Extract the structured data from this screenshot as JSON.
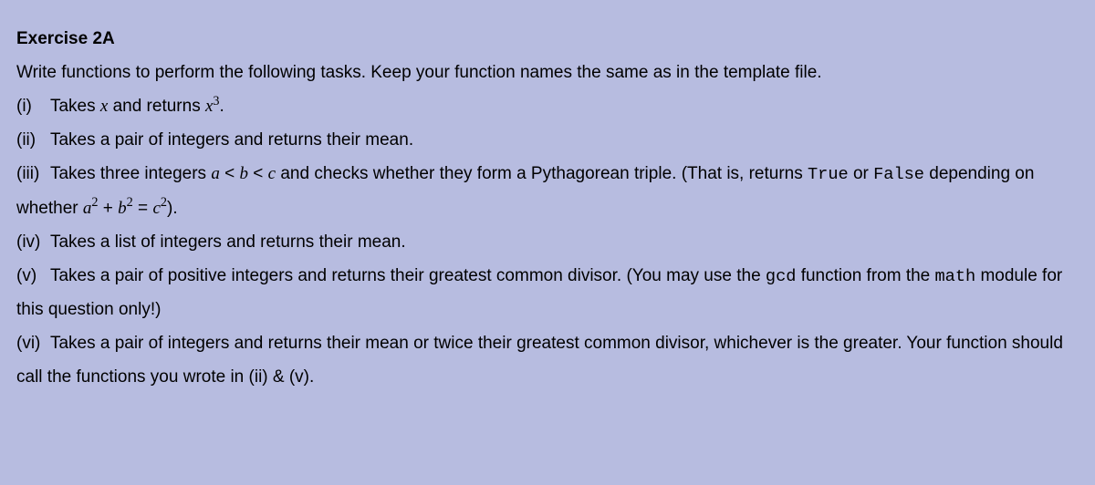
{
  "title": "Exercise 2A",
  "intro": "Write functions to perform the following tasks. Keep your function names the same as in the template file.",
  "items": {
    "i": {
      "label": "(i)"
    },
    "ii": {
      "label": "(ii)",
      "text": "Takes a pair of integers and returns their mean."
    },
    "iii": {
      "label": "(iii)"
    },
    "iv": {
      "label": "(iv)",
      "text": "Takes a list of integers and returns their mean."
    },
    "v": {
      "label": "(v)"
    },
    "vi": {
      "label": "(vi)"
    }
  },
  "text": {
    "i_pre": "Takes ",
    "i_mid": " and returns ",
    "i_post": ".",
    "iii_pre": "Takes three integers ",
    "iii_post": " and checks whether they form a Pythagorean triple. (That is, returns ",
    "iii_or": " or ",
    "iii_dep": " depending on whether ",
    "iii_end": ").",
    "v_pre": "Takes a pair of positive integers and returns their greatest common divisor. (You may use the ",
    "v_mid": " function from the ",
    "v_post": " module for this question only!)",
    "vi_text": "Takes a pair of integers and returns their mean or twice their greatest common divisor, whichever is the greater. Your function should call the functions you wrote in (ii) & (v)."
  },
  "math": {
    "x": "x",
    "x3_base": "x",
    "x3_exp": "3",
    "a": "a",
    "b": "b",
    "c": "c",
    "lt": " < ",
    "a2_exp": "2",
    "b2_exp": "2",
    "c2_exp": "2",
    "plus": " + ",
    "eq": " = "
  },
  "code": {
    "true": "True",
    "false": "False",
    "gcd": "gcd",
    "math": "math"
  }
}
